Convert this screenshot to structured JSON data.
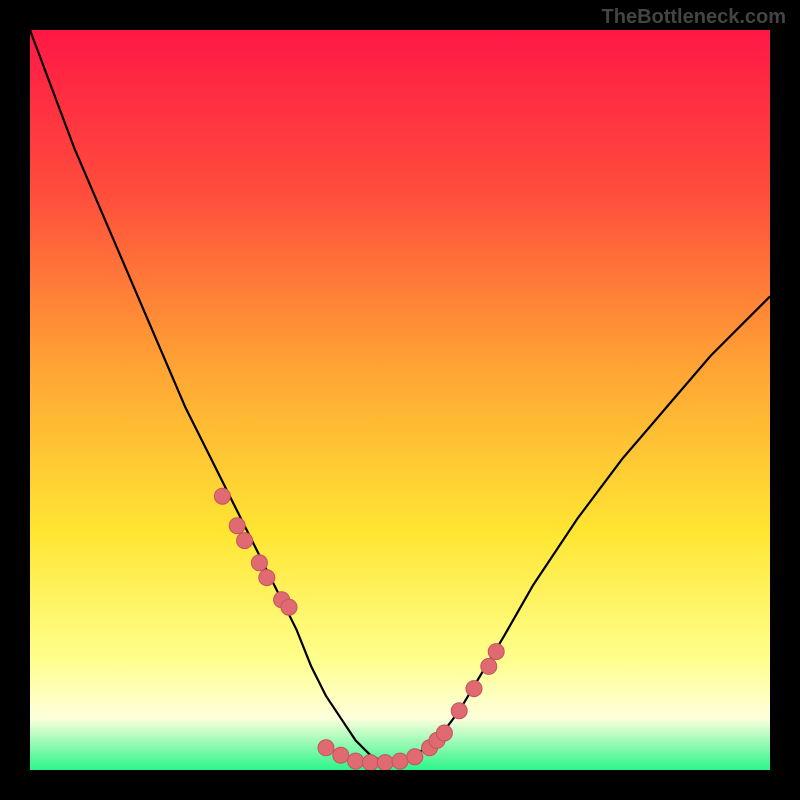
{
  "header": {
    "attribution": "TheBottleneck.com"
  },
  "colors": {
    "frame": "#000000",
    "gradient_top": "#ff1846",
    "gradient_mid1": "#ff4d3c",
    "gradient_mid2": "#ffa234",
    "gradient_mid3": "#ffe633",
    "gradient_lower": "#ffff8c",
    "gradient_pale": "#fdffdc",
    "gradient_bottom": "#2cf58a",
    "curve": "#000000",
    "marker_fill": "#e06a72",
    "marker_stroke": "#c3545c"
  },
  "chart_data": {
    "type": "line",
    "title": "",
    "xlabel": "",
    "ylabel": "",
    "xlim": [
      0,
      100
    ],
    "ylim": [
      0,
      100
    ],
    "grid": false,
    "legend": false,
    "series": [
      {
        "name": "bottleneck-curve",
        "x": [
          0,
          3,
          6,
          9,
          12,
          15,
          18,
          21,
          24,
          27,
          30,
          33,
          36,
          38,
          40,
          42,
          44,
          46,
          48,
          50,
          52,
          55,
          58,
          61,
          64,
          68,
          74,
          80,
          86,
          92,
          98,
          100
        ],
        "y": [
          100,
          92,
          84,
          77,
          70,
          63,
          56,
          49,
          43,
          37,
          31,
          25,
          19,
          14,
          10,
          7,
          4,
          2,
          1,
          1,
          2,
          4,
          8,
          13,
          18,
          25,
          34,
          42,
          49,
          56,
          62,
          64
        ]
      }
    ],
    "markers": {
      "name": "highlight-points",
      "x": [
        26,
        28,
        29,
        31,
        32,
        34,
        35,
        40,
        42,
        44,
        46,
        48,
        50,
        52,
        54,
        55,
        56,
        58,
        60,
        62,
        63
      ],
      "y": [
        37,
        33,
        31,
        28,
        26,
        23,
        22,
        3,
        2,
        1.2,
        1,
        1,
        1.2,
        1.8,
        3,
        4,
        5,
        8,
        11,
        14,
        16
      ]
    }
  }
}
